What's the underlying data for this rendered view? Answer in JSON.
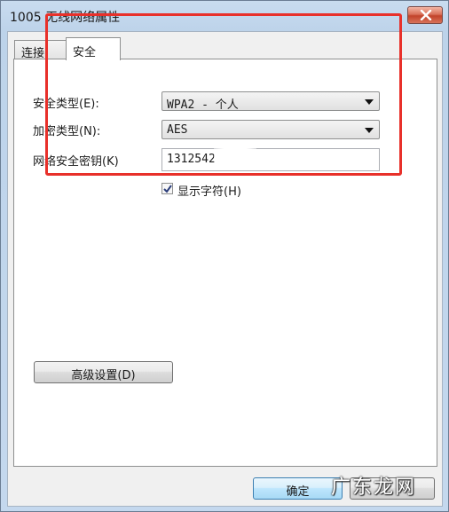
{
  "window": {
    "title": "1005 无线网络属性",
    "close_label": "×"
  },
  "tabs": [
    {
      "label": "连接",
      "selected": false
    },
    {
      "label": "安全",
      "selected": true
    }
  ],
  "security": {
    "type_label": "安全类型(E):",
    "type_value": "WPA2 - 个人",
    "encryption_label": "加密类型(N):",
    "encryption_value": "AES",
    "key_label": "网络安全密钥(K)",
    "key_value": "1312542",
    "show_chars_label": "显示字符(H)",
    "show_chars_checked": true
  },
  "buttons": {
    "advanced": "高级设置(D)",
    "ok": "确定",
    "cancel": ""
  },
  "watermark": "广东龙网",
  "colors": {
    "highlight": "#e8302a"
  }
}
